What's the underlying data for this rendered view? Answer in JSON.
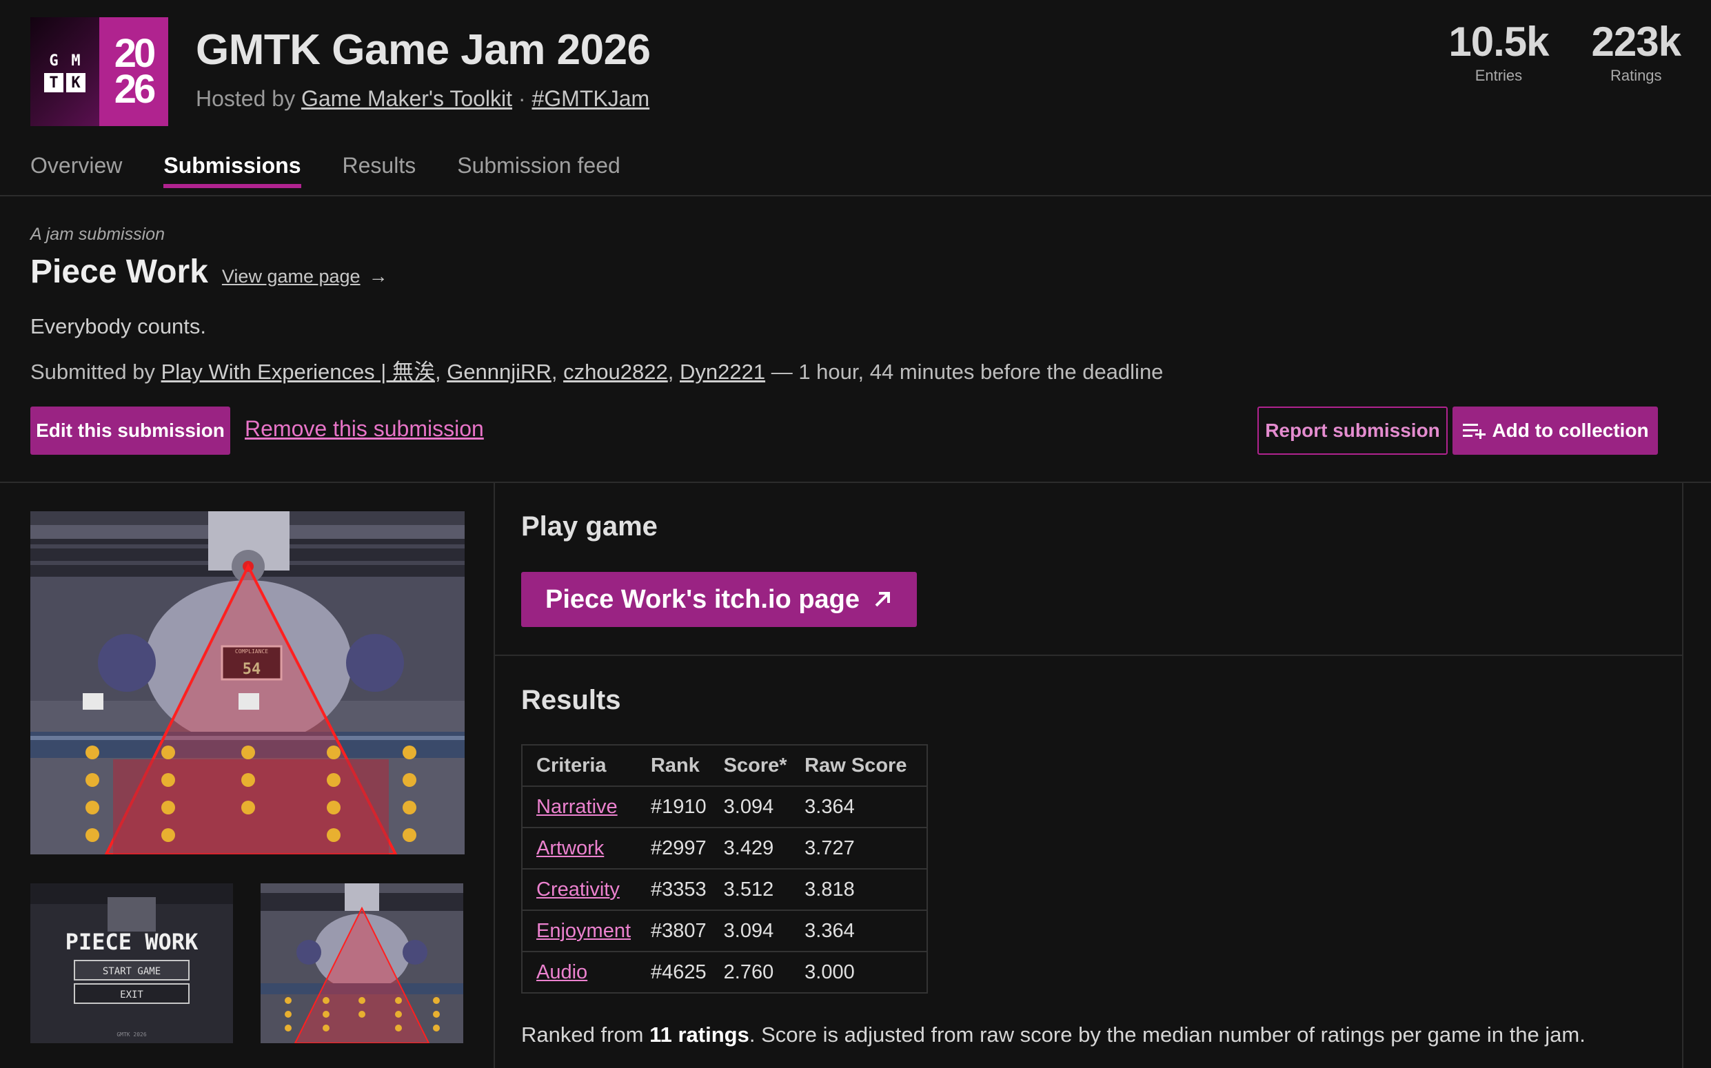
{
  "jam": {
    "logo_letters": [
      "G",
      "M",
      "T",
      "K"
    ],
    "logo_year_top": "20",
    "logo_year_bottom": "26",
    "title": "GMTK Game Jam 2026",
    "hosted_prefix": "Hosted by",
    "host_name": "Game Maker's Toolkit",
    "separator": "·",
    "hashtag": "#GMTKJam",
    "stats": [
      {
        "value": "10.5k",
        "label": "Entries"
      },
      {
        "value": "223k",
        "label": "Ratings"
      }
    ]
  },
  "tabs": [
    {
      "label": "Overview",
      "active": false
    },
    {
      "label": "Submissions",
      "active": true
    },
    {
      "label": "Results",
      "active": false
    },
    {
      "label": "Submission feed",
      "active": false
    }
  ],
  "submission": {
    "subtitle": "A jam submission",
    "title": "Piece Work",
    "view_link": "View game page",
    "view_arrow": "→",
    "tagline": "Everybody counts.",
    "submitted_prefix": "Submitted by",
    "authors": [
      "Play With Experiences | 無涘",
      "GennnjiRR",
      "czhou2822",
      "Dyn2221"
    ],
    "deadline_note": "— 1 hour, 44 minutes before the deadline"
  },
  "actions": {
    "edit": "Edit this submission",
    "remove": "Remove this submission",
    "report": "Report submission",
    "add_collection": "Add to collection"
  },
  "screenshots": {
    "main_counter": "54",
    "main_counter_label": "COMPLIANCE",
    "thumb1_title": "PIECE WORK",
    "thumb1_start": "START GAME",
    "thumb1_exit": "EXIT",
    "thumb1_footer": "GMTK 2026"
  },
  "play": {
    "heading": "Play game",
    "button": "Piece Work's itch.io page"
  },
  "results": {
    "heading": "Results",
    "columns": [
      "Criteria",
      "Rank",
      "Score*",
      "Raw Score"
    ],
    "rows": [
      {
        "criteria": "Narrative",
        "rank": "#1910",
        "score": "3.094",
        "raw": "3.364"
      },
      {
        "criteria": "Artwork",
        "rank": "#2997",
        "score": "3.429",
        "raw": "3.727"
      },
      {
        "criteria": "Creativity",
        "rank": "#3353",
        "score": "3.512",
        "raw": "3.818"
      },
      {
        "criteria": "Enjoyment",
        "rank": "#3807",
        "score": "3.094",
        "raw": "3.364"
      },
      {
        "criteria": "Audio",
        "rank": "#4625",
        "score": "2.760",
        "raw": "3.000"
      }
    ],
    "note_prefix": "Ranked from",
    "note_bold": "11 ratings",
    "note_suffix": ". Score is adjusted from raw score by the median number of ratings per game in the jam."
  },
  "colors": {
    "accent": "#9a2383",
    "link_pink": "#ec82cf",
    "background": "#121212"
  },
  "icons": {
    "add_collection": "playlist-add-icon",
    "external": "arrow-up-right-icon",
    "view_arrow": "arrow-right-icon"
  }
}
